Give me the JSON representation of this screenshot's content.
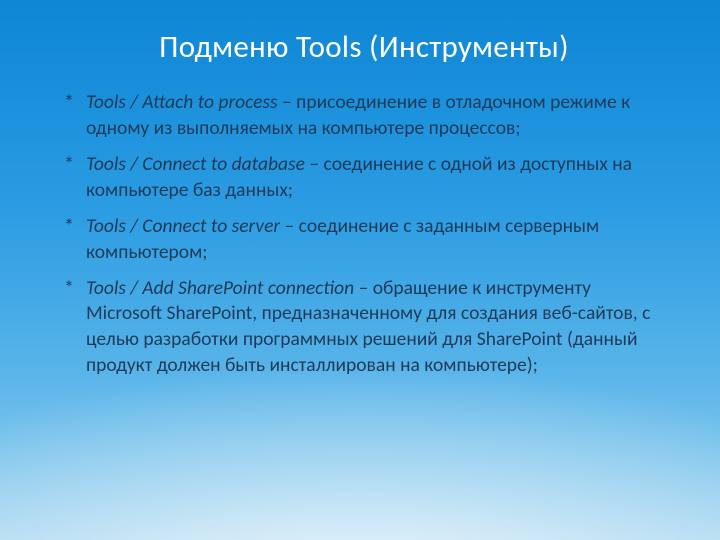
{
  "title": "Подменю Tools (Инструменты)",
  "items": [
    {
      "path": "Tools / Attach to process",
      "desc": " – присоединение в отладочном режиме к одному из выполняемых на компьютере процессов;"
    },
    {
      "path": "Tools / Connect to database",
      "desc": " – соединение с одной из доступных на компьютере баз данных;"
    },
    {
      "path": "Tools / Connect to server",
      "desc": " – соединение с заданным серверным компьютером;"
    },
    {
      "path": "Tools / Add SharePoint connection",
      "desc": " – обращение к инструменту Microsoft SharePoint, предназначенному для создания веб-сайтов, с целью разработки программных решений для SharePoint (данный продукт должен быть инсталлирован на компьютере);"
    }
  ]
}
